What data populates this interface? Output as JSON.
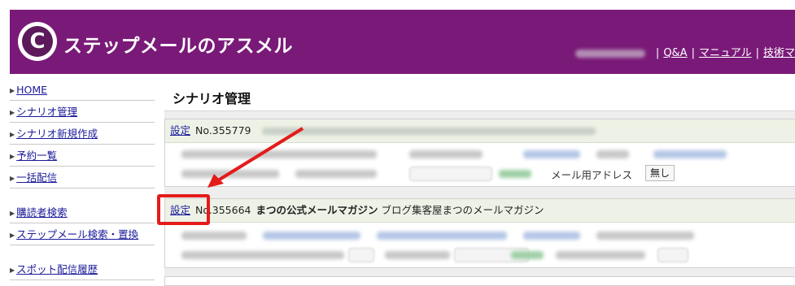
{
  "header": {
    "brand": "ステップメールのアスメル",
    "logo_icon": "asmel-logo-icon",
    "links": [
      "Q&A",
      "マニュアル",
      "技術マ"
    ],
    "separator": "|"
  },
  "sidebar": {
    "items": [
      {
        "label": "HOME"
      },
      {
        "label": "シナリオ管理"
      },
      {
        "label": "シナリオ新規作成"
      },
      {
        "label": "予約一覧"
      },
      {
        "label": "一括配信"
      },
      {
        "label": "購読者検索"
      },
      {
        "label": "ステップメール検索・置換"
      },
      {
        "label": "スポット配信履歴"
      }
    ]
  },
  "main": {
    "title": "シナリオ管理",
    "scenarios": [
      {
        "settings_label": "設定",
        "number": "No.355779",
        "name": "",
        "sub": "",
        "mail_label": "メール用アドレス",
        "toggle_value": "無し"
      },
      {
        "settings_label": "設定",
        "number": "No.355664",
        "name": "まつの公式メールマガジン",
        "sub": "ブログ集客屋まつのメールマガジン"
      }
    ]
  },
  "annotation": {
    "color": "#e41b1b"
  }
}
